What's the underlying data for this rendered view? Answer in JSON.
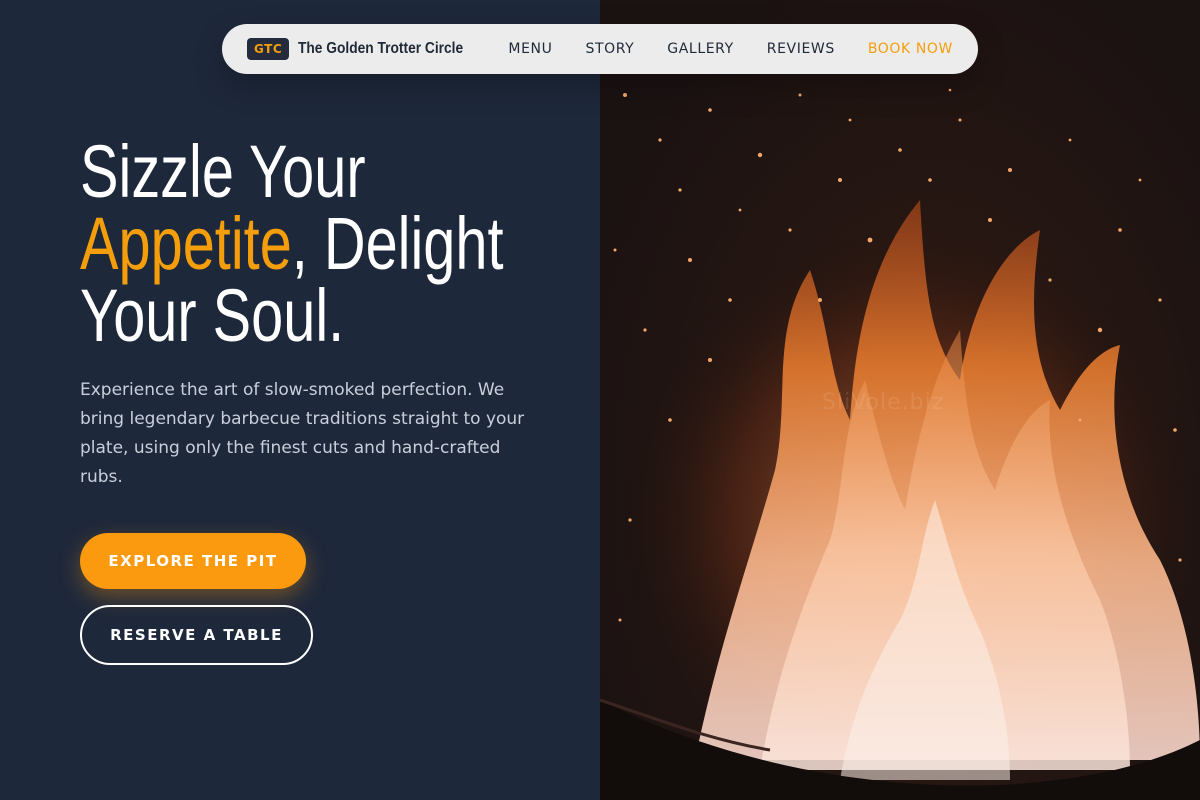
{
  "nav": {
    "logo_badge": "GTC",
    "brand_name": "The Golden Trotter Circle",
    "links": [
      "MENU",
      "STORY",
      "GALLERY",
      "REVIEWS"
    ],
    "cta": "BOOK NOW"
  },
  "hero": {
    "title_line1": "Sizzle Your",
    "title_accent": "Appetite",
    "title_line2_rest": ", Delight",
    "title_line3": "Your Soul.",
    "description": "Experience the art of slow-smoked perfection. We bring legendary barbecue traditions straight to your plate, using only the finest cuts and hand-crafted rubs.",
    "primary_button": "EXPLORE THE PIT",
    "secondary_button": "RESERVE A TABLE"
  },
  "image": {
    "watermark": "SliVole.biz",
    "icon": "campfire-photo"
  },
  "colors": {
    "background": "#1e283b",
    "accent": "#f59e0b",
    "nav_bg": "#ececec"
  }
}
